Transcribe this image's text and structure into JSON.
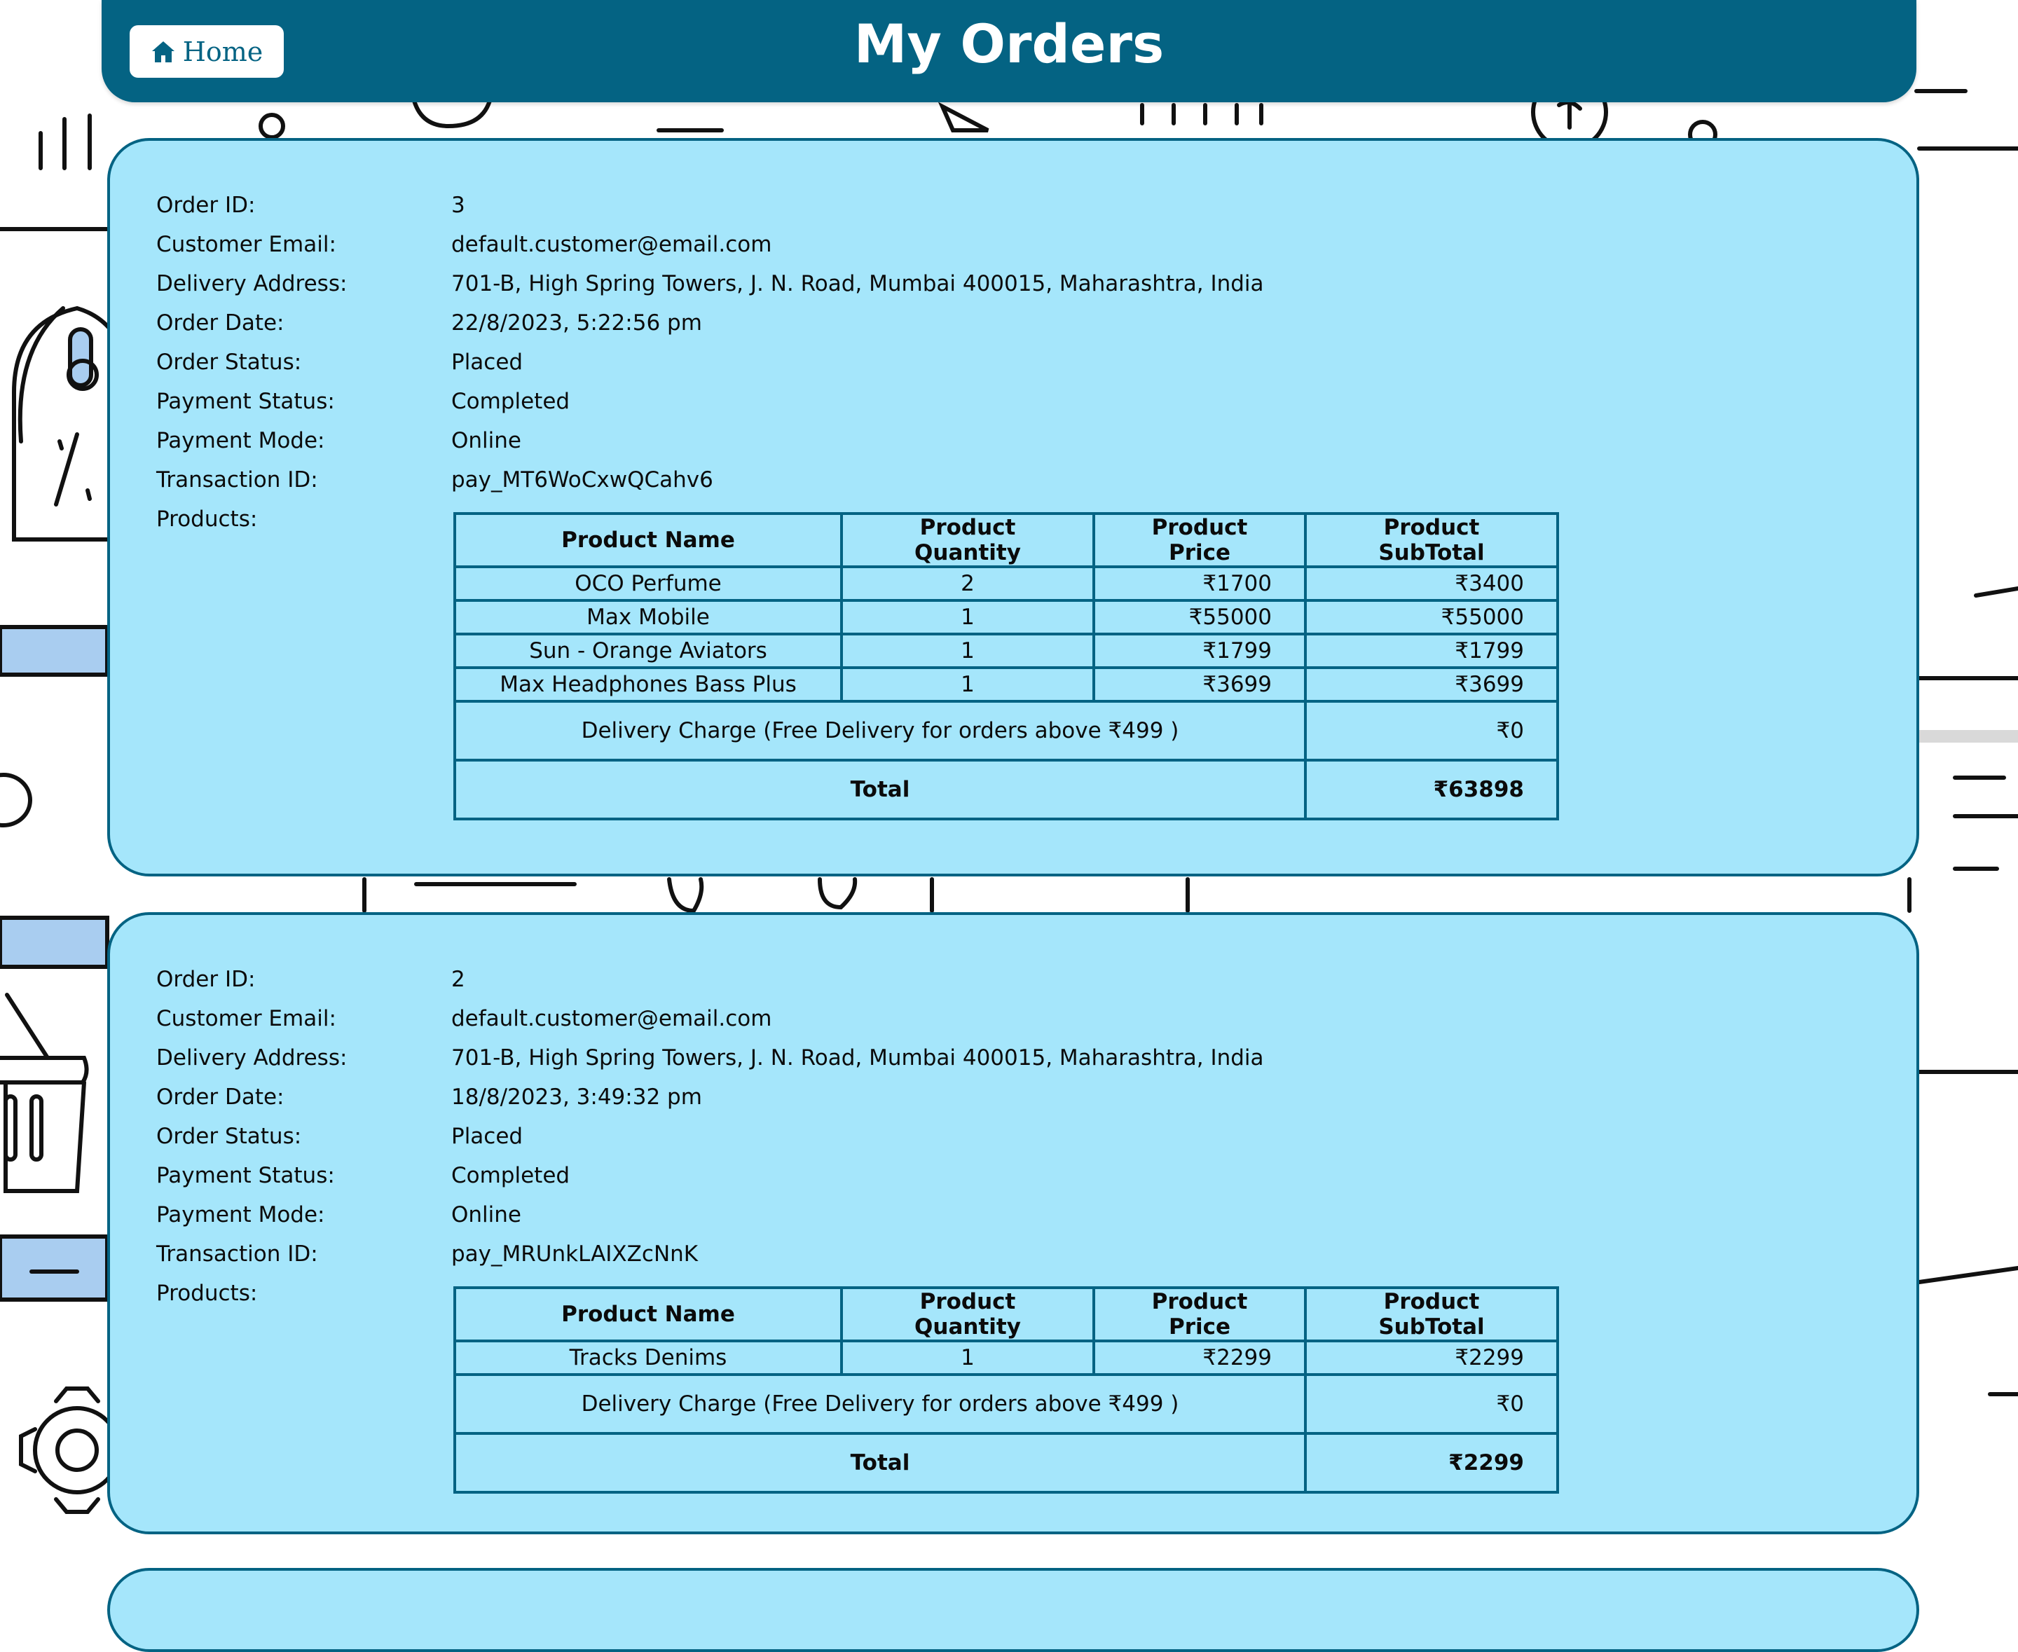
{
  "header": {
    "home_label": "Home",
    "title": "My Orders"
  },
  "labels": {
    "order_id": "Order ID:",
    "customer_email": "Customer Email:",
    "delivery_address": "Delivery Address:",
    "order_date": "Order Date:",
    "order_status": "Order Status:",
    "payment_status": "Payment Status:",
    "payment_mode": "Payment Mode:",
    "transaction_id": "Transaction ID:",
    "products": "Products:"
  },
  "table_headers": [
    "Product Name",
    "Product Quantity",
    "Product Price",
    "Product SubTotal"
  ],
  "orders": [
    {
      "order_id": "3",
      "customer_email": "default.customer@email.com",
      "delivery_address": "701-B, High Spring Towers, J. N. Road, Mumbai 400015, Maharashtra, India",
      "order_date": "22/8/2023, 5:22:56 pm",
      "order_status": "Placed",
      "payment_status": "Completed",
      "payment_mode": "Online",
      "transaction_id": "pay_MT6WoCxwQCahv6",
      "items": [
        {
          "name": "OCO Perfume",
          "qty": "2",
          "price": "₹1700",
          "subtotal": "₹3400"
        },
        {
          "name": "Max Mobile",
          "qty": "1",
          "price": "₹55000",
          "subtotal": "₹55000"
        },
        {
          "name": "Sun - Orange Aviators",
          "qty": "1",
          "price": "₹1799",
          "subtotal": "₹1799"
        },
        {
          "name": "Max Headphones Bass Plus",
          "qty": "1",
          "price": "₹3699",
          "subtotal": "₹3699"
        }
      ],
      "delivery_label": "Delivery Charge (Free Delivery for orders above ₹499 )",
      "delivery_value": "₹0",
      "total_label": "Total",
      "total_value": "₹63898"
    },
    {
      "order_id": "2",
      "customer_email": "default.customer@email.com",
      "delivery_address": "701-B, High Spring Towers, J. N. Road, Mumbai 400015, Maharashtra, India",
      "order_date": "18/8/2023, 3:49:32 pm",
      "order_status": "Placed",
      "payment_status": "Completed",
      "payment_mode": "Online",
      "transaction_id": "pay_MRUnkLAIXZcNnK",
      "items": [
        {
          "name": "Tracks Denims",
          "qty": "1",
          "price": "₹2299",
          "subtotal": "₹2299"
        }
      ],
      "delivery_label": "Delivery Charge (Free Delivery for orders above ₹499 )",
      "delivery_value": "₹0",
      "total_label": "Total",
      "total_value": "₹2299"
    }
  ],
  "colors": {
    "header": "#046383",
    "card": "#a5e6fb",
    "border": "#046383"
  }
}
